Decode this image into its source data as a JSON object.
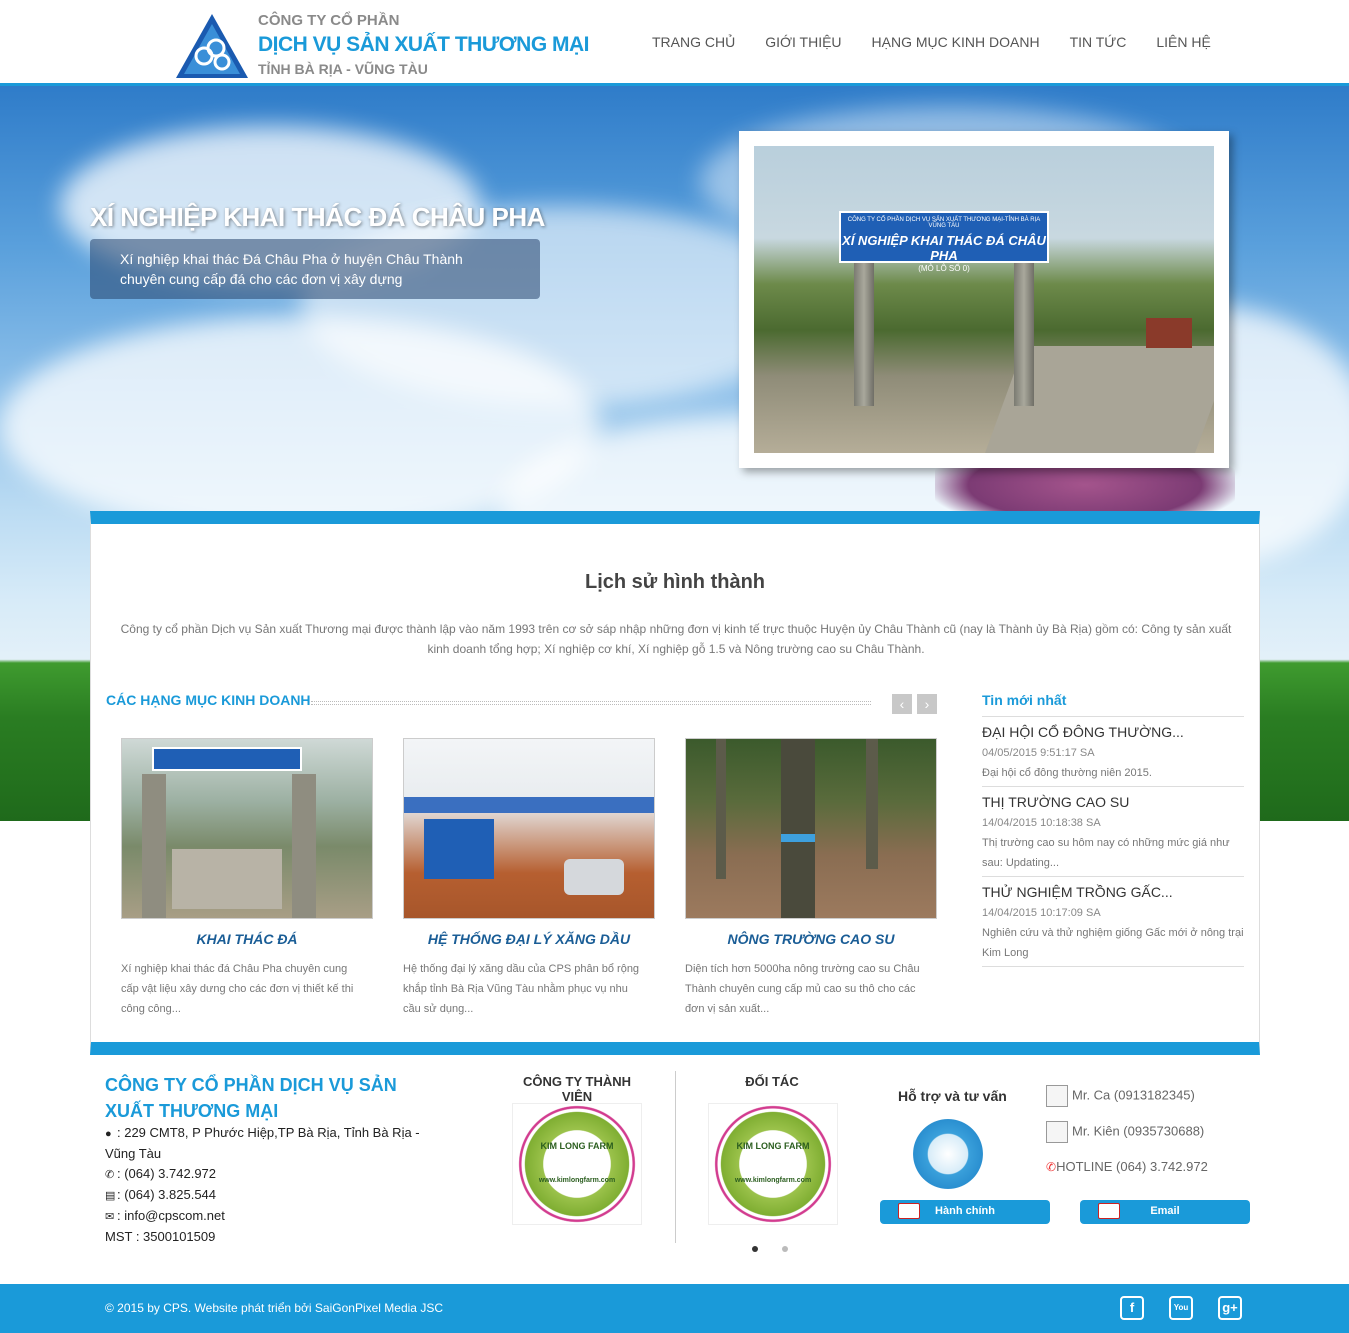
{
  "header": {
    "brand_line1": "CÔNG TY CỔ PHẦN",
    "brand_line2": "DỊCH VỤ SẢN XUẤT THƯƠNG MẠI",
    "brand_line3": "TỈNH BÀ RỊA - VŨNG TÀU",
    "nav": [
      "TRANG CHỦ",
      "GIỚI THIỆU",
      "HẠNG MỤC KINH DOANH",
      "TIN TỨC",
      "LIÊN HỆ"
    ]
  },
  "hero": {
    "title": "XÍ NGHIỆP KHAI THÁC ĐÁ CHÂU PHA",
    "desc_line1": "Xí nghiệp khai thác Đá Châu Pha ở huyện Châu Thành",
    "desc_line2": "chuyên cung cấp đá cho các đơn vị xây dựng",
    "photo_sign_small": "CÔNG TY CỔ PHẦN DỊCH VỤ SẢN XUẤT THƯƠNG MẠI-TỈNH BÀ RỊA VŨNG TÀU",
    "photo_sign_big": "XÍ NGHIỆP KHAI THÁC ĐÁ CHÂU PHA",
    "photo_sign_sub": "(MỎ LÔ SỐ 0)"
  },
  "history": {
    "title": "Lịch sử hình thành",
    "text_line1": "Công ty cổ phần Dịch vụ Sản xuất Thương mại được thành lập vào năm 1993 trên cơ sở sáp nhập những đơn vị kinh tế trực thuộc Huyện ủy Châu Thành cũ (nay là Thành ủy Bà Rịa) gồm có: Công ty sản xuất",
    "text_line2": "kinh doanh tổng hợp; Xí nghiệp cơ khí, Xí nghiệp gỗ 1.5 và Nông trường cao su Châu Thành."
  },
  "business": {
    "heading": "CÁC HẠNG MỤC KINH DOANH",
    "prev": "‹",
    "next": "›",
    "items": [
      {
        "title": "KHAI THÁC ĐÁ",
        "desc": "Xí nghiệp khai thác đá Châu Pha chuyên cung cấp vật liệu xây dưng cho các đơn vị thiết kế thi công công..."
      },
      {
        "title": "HỆ THỐNG ĐẠI LÝ XĂNG DẦU",
        "desc": "Hệ thống đại lý xăng dầu của CPS phân bổ rộng khắp tỉnh Bà Rịa Vũng Tàu nhằm phục vụ nhu cầu sử dụng..."
      },
      {
        "title": "NÔNG TRƯỜNG CAO SU",
        "desc": "Diện tích hơn 5000ha nông trường cao su Châu Thành chuyên cung cấp mủ cao su thô cho các đơn vị sản xuất..."
      }
    ]
  },
  "news": {
    "heading": "Tin mới nhất",
    "items": [
      {
        "title": "ĐẠI HỘI CỔ ĐÔNG THƯỜNG...",
        "date": "04/05/2015 9:51:17 SA",
        "desc": "Đại hội cổ đông thường niên 2015."
      },
      {
        "title": "THỊ TRƯỜNG CAO SU",
        "date": "14/04/2015 10:18:38 SA",
        "desc": "Thị trường cao su hôm nay có những mức giá như sau: Updating..."
      },
      {
        "title": "THỬ NGHIỆM TRỒNG GẤC...",
        "date": "14/04/2015 10:17:09 SA",
        "desc": "Nghiên cứu và thử nghiệm giống Gấc mới ở nông trại Kim Long"
      }
    ]
  },
  "footer": {
    "company": "CÔNG TY CỔ PHẦN DỊCH VỤ SẢN XUẤT THƯƠNG MẠI",
    "address": ": 229 CMT8, P Phước Hiệp,TP Bà Rịa, Tỉnh Bà Rịa - Vũng Tàu",
    "phone": ": (064) 3.742.972",
    "fax": ": (064) 3.825.544",
    "email": ": info@cpscom.net",
    "tax": "MST : 3500101509",
    "member_title": "CÔNG TY THÀNH VIÊN",
    "partner_title": "ĐỐI TÁC",
    "logo_top": "KIM LONG FARM",
    "logo_bottom": "www.kimlongfarm.com",
    "support_title": "Hỗ trợ và tư vấn",
    "btn_admin": "Hành chính",
    "btn_email": "Email",
    "contact1": "Mr. Ca (0913182345)",
    "contact2": "Mr. Kiên (0935730688)",
    "hotline": "HOTLINE (064) 3.742.972",
    "copyright": "© 2015 by CPS. Website phát triển bởi SaiGonPixel Media JSC",
    "social": [
      "f",
      "You",
      "g+"
    ]
  },
  "colors": {
    "accent": "#1a9ad9",
    "title_blue": "#1a5d96"
  }
}
